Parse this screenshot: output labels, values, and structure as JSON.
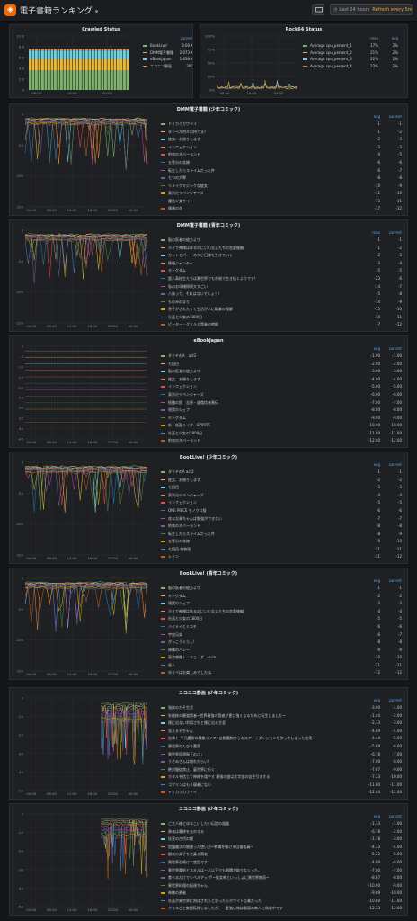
{
  "header": {
    "title": "電子書籍ランキング",
    "time_range": "Last 24 hours",
    "refresh": "Refresh every 5m"
  },
  "crawled": {
    "title": "Crawled Status",
    "col": "current",
    "legend": [
      {
        "name": "BookLive!",
        "value": "3.60 K",
        "color": "#7eb26d"
      },
      {
        "name": "DMM電子書籍",
        "value": "2.073 K",
        "color": "#eab839"
      },
      {
        "name": "eBookJapan",
        "value": "1.638 K",
        "color": "#6ed0e0"
      },
      {
        "name": "ニコニコ静画",
        "value": "300",
        "color": "#ef843c"
      }
    ],
    "chart_data": {
      "type": "bar",
      "y_ticks": [
        "10 K",
        "8 K",
        "6 K",
        "4 K",
        "2 K",
        "0"
      ],
      "x_ticks": [
        "08:00",
        "16:00",
        "00:00"
      ],
      "ylim": [
        0,
        10000
      ],
      "stacked": true,
      "series": [
        {
          "name": "BookLive!",
          "value": 3600
        },
        {
          "name": "DMM電子書籍",
          "value": 2073
        },
        {
          "name": "eBookJapan",
          "value": 1638
        },
        {
          "name": "ニコニコ静画",
          "value": 300
        }
      ]
    }
  },
  "rock64": {
    "title": "Rock64 Status",
    "cols": [
      "max",
      "avg"
    ],
    "legend": [
      {
        "name": "Average cpu_percent_1",
        "v1": "17%",
        "v2": "3%",
        "color": "#7eb26d"
      },
      {
        "name": "Average cpu_percent_2",
        "v1": "21%",
        "v2": "2%",
        "color": "#eab839"
      },
      {
        "name": "Average cpu_percent_3",
        "v1": "22%",
        "v2": "2%",
        "color": "#6ed0e0"
      },
      {
        "name": "Average cpu_percent_4",
        "v1": "22%",
        "v2": "2%",
        "color": "#ef843c"
      }
    ],
    "chart_data": {
      "type": "line",
      "y_ticks": [
        "100%",
        "75%",
        "50%",
        "25%",
        "0%"
      ],
      "x_ticks": [
        "08:00",
        "16:00",
        "00:00"
      ],
      "ylim": [
        0,
        100
      ]
    }
  },
  "panels": [
    {
      "title": "DMM電子書籍 (少年コミック)",
      "cols": [
        "avg",
        "current"
      ],
      "y_ticks": [
        "0",
        "-50",
        "-100",
        "-150"
      ],
      "x_ticks": [
        "04:00",
        "08:00",
        "12:00",
        "16:00",
        "20:00",
        "00:00"
      ],
      "rows": [
        [
          "ドミカクカワイイ",
          "-1",
          "-1"
        ],
        [
          "ダンベル何キロ持てる?",
          "-1",
          "-2"
        ],
        [
          "彼女、お借りします",
          "-2",
          "-3"
        ],
        [
          "インフェクション",
          "-3",
          "-3"
        ],
        [
          "約束のネバーランド",
          "-4",
          "-5"
        ],
        [
          "五等分の花嫁",
          "-6",
          "-6"
        ],
        [
          "転生したらスライムだった件",
          "-6",
          "-7"
        ],
        [
          "七つの大罪",
          "-8",
          "-8"
        ],
        [
          "リメイクマジックな彼女",
          "-10",
          "-9"
        ],
        [
          "東京卍リベンジャーズ",
          "-11",
          "-10"
        ],
        [
          "魔法少女サイト",
          "-13",
          "-11"
        ],
        [
          "僕達の花",
          "-17",
          "-12"
        ]
      ]
    },
    {
      "title": "DMM電子書籍 (青年コミック)",
      "cols": [
        "max",
        "current"
      ],
      "y_ticks": [
        "0",
        "-50",
        "-100",
        "-150"
      ],
      "x_ticks": [
        "04:00",
        "08:00",
        "12:00",
        "16:00",
        "20:00",
        "00:00"
      ],
      "rows": [
        [
          "脳の医者の彼方より",
          "-1",
          "-1"
        ],
        [
          "ホイで神様はゆるのにいい太またちの恋愛後編",
          "-1",
          "-2"
        ],
        [
          "カットとパートのクビ日常を生きていく",
          "-2",
          "-3"
        ],
        [
          "情報ジャンキー",
          "-3",
          "-4"
        ],
        [
          "キングダム",
          "-5",
          "-5"
        ],
        [
          "超人高校生たちは異世界でも余裕で生き抜くようです!",
          "-23",
          "-6"
        ],
        [
          "私のお母様探偵大すごい",
          "-14",
          "-7"
        ],
        [
          "八族って、それはないでしょう!",
          "-5",
          "-8"
        ],
        [
          "ものみのまり",
          "-14",
          "-9"
        ],
        [
          "息子がされたくて生活が人に職業の理解",
          "-15",
          "-10"
        ],
        [
          "社畜と少女の1800日",
          "-10",
          "-11"
        ],
        [
          "ピーター・グリルと賢者の時間",
          "-7",
          "-12"
        ]
      ]
    },
    {
      "title": "eBookJapan",
      "cols": [
        "avg",
        "current"
      ],
      "y_ticks": [
        "0",
        "-5",
        "-10",
        "-15",
        "-20",
        "-25",
        "-30",
        "-35",
        "-40",
        "-45"
      ],
      "x_ticks": [
        "04:00",
        "08:00",
        "12:00",
        "16:00",
        "20:00",
        "00:00"
      ],
      "rows": [
        [
          "ダイヤのA　act2",
          "-1.00",
          "-1.00"
        ],
        [
          "七回目",
          "-2.00",
          "-2.00"
        ],
        [
          "脳の医者の彼方より",
          "-3.00",
          "-3.00"
        ],
        [
          "彼女、お借りします",
          "-4.00",
          "-4.00"
        ],
        [
          "インフェクション",
          "-5.00",
          "-5.00"
        ],
        [
          "東京卍リベンジャーズ",
          "-6.00",
          "-6.00"
        ],
        [
          "極醜の国　志恵・盛倫信者異伝",
          "-7.00",
          "-7.00"
        ],
        [
          "現実のシェフ",
          "-8.00",
          "-8.00"
        ],
        [
          "キングダム",
          "-9.00",
          "-9.00"
        ],
        [
          "新　仮面ライダーSPIRITS",
          "-10.00",
          "-10.00"
        ],
        [
          "社畜と少女の1800日",
          "-11.00",
          "-11.00"
        ],
        [
          "約束のネバーランド",
          "-12.00",
          "-12.00"
        ]
      ]
    },
    {
      "title": "BookLive! (少年コミック)",
      "cols": [
        "avg",
        "current"
      ],
      "y_ticks": [
        "0",
        "-50",
        "-100",
        "-150"
      ],
      "x_ticks": [
        "04:00",
        "08:00",
        "12:00",
        "16:00",
        "20:00",
        "00:00"
      ],
      "rows": [
        [
          "ダイヤのA act2",
          "-1",
          "-1"
        ],
        [
          "彼女、お借りします",
          "-2",
          "-2"
        ],
        [
          "七回目",
          "-3",
          "-3"
        ],
        [
          "東京卍リベンジャーズ",
          "-4",
          "-4"
        ],
        [
          "インフェクション",
          "-5",
          "-5"
        ],
        [
          "ONE PIECE モノクロ版",
          "-6",
          "-6"
        ],
        [
          "花なな青ちゃんは勉強ができない",
          "-7",
          "-7"
        ],
        [
          "約束のネバーランド",
          "-8",
          "-8"
        ],
        [
          "転生したらスライムだった件",
          "-8",
          "-9"
        ],
        [
          "五等分の花嫁",
          "-9",
          "-10"
        ],
        [
          "七回目 特装版",
          "-11",
          "-11"
        ],
        [
          "レイン",
          "-11",
          "-12"
        ]
      ]
    },
    {
      "title": "BookLive! (青年コミック)",
      "cols": [
        "avg",
        "current"
      ],
      "y_ticks": [
        "0",
        "-50",
        "-100",
        "-150"
      ],
      "x_ticks": [
        "04:00",
        "08:00",
        "12:00",
        "16:00",
        "20:00",
        "00:00"
      ],
      "rows": [
        [
          "脳の医者の彼方より",
          "-1",
          "-1"
        ],
        [
          "キングダム",
          "-2",
          "-2"
        ],
        [
          "現実のシェフ",
          "-3",
          "-3"
        ],
        [
          "ホイで神様はゆるのにいい太またちの恋愛後編",
          "-4",
          "-4"
        ],
        [
          "社畜と少女の1800日",
          "-5",
          "-5"
        ],
        [
          "ハクメイとミコチ",
          "-6",
          "-6"
        ],
        [
          "宇宙兄弟",
          "-6",
          "-7"
        ],
        [
          "がっこうぐらし!",
          "-8",
          "-8"
        ],
        [
          "神様のバレー",
          "-9",
          "-9"
        ],
        [
          "東京喰種トーキョーグール:re",
          "-10",
          "-10"
        ],
        [
          "風人",
          "-21",
          "-11"
        ],
        [
          "ゆうべはお楽しみでしたね",
          "-12",
          "-12"
        ]
      ]
    },
    {
      "title": "ニコニコ静画 (少年コミック)",
      "cols": [
        "avg",
        "current"
      ],
      "y_ticks": [
        "0",
        "-10",
        "-20",
        "-30",
        "-40",
        "-50"
      ],
      "x_ticks": [
        "04:00",
        "08:00",
        "12:00",
        "16:00",
        "20:00",
        "00:00"
      ],
      "rows": [
        [
          "強欲のたそ生活",
          "-3.00",
          "-1.00"
        ],
        [
          "失格紋の最強賢者~世界最強の賢者が更に強くなるために転生しました~",
          "-1.44",
          "-2.00"
        ],
        [
          "僕に出ない利用されと僕に出る主君",
          "-2.33",
          "-3.00"
        ],
        [
          "見えるデちゃん",
          "-4.89",
          "-4.00"
        ],
        [
          "血骨ド-平凡魔術の凝集ライフ~自動魔物からのスアートダンジョンを作ってしまった結果~",
          "-4.44",
          "-5.00"
        ],
        [
          "異世界のんびり農家",
          "-5.89",
          "-6.00"
        ],
        [
          "異世界居酒屋「のぶ」",
          "-6.78",
          "-7.00"
        ],
        [
          "うさみさんは触れたらい!",
          "-7.00",
          "-8.00"
        ],
        [
          "絶対服従禁止、裏世界に行く",
          "-7.67",
          "-9.00"
        ],
        [
          "ホタルを信じて神様を増やす 最強の蛍は文字蛍の自主引きする",
          "-7.33",
          "-10.00"
        ],
        [
          "ゴブリンはもう弱者にない",
          "-11.00",
          "-11.00"
        ],
        [
          "ドミカクカワイイ",
          "-12.44",
          "-12.00"
        ]
      ]
    },
    {
      "title": "ニコニコ静画 (少年コミック)",
      "cols": [
        "avg",
        "current"
      ],
      "y_ticks": [
        "0",
        "-10",
        "-20",
        "-30",
        "-40",
        "-50"
      ],
      "x_ticks": [
        "04:00",
        "08:00",
        "12:00",
        "16:00",
        "20:00",
        "00:00"
      ],
      "rows": [
        [
          "ご主人様とゆるこいしたい伝説の道器",
          "-1.33",
          "-1.00"
        ],
        [
          "勇者は最終を支のろる",
          "-6.78",
          "-2.00"
        ],
        [
          "託宣の古代の鍵",
          "-1.78",
          "-3.00"
        ],
        [
          "加護魔法の間違った使い方~戦場を駆ける回復要員~",
          "-4.33",
          "-4.00"
        ],
        [
          "蹴者の弟子を名乗る賢者",
          "-5.22",
          "-5.00"
        ],
        [
          "異世界召喚は二度目です",
          "-4.89",
          "-6.00"
        ],
        [
          "異世界魔術とスキルは一人以下でも問題が取りなくった。",
          "-7.00",
          "-7.00"
        ],
        [
          "食べるだけでレベルアップ!~駄女神といっしょに異世界無双~",
          "-8.67",
          "-8.00"
        ],
        [
          "異世界料理の配達ちゃん",
          "-10.00",
          "-9.00"
        ],
        [
          "神様の勇者",
          "-9.89",
          "-10.00"
        ],
        [
          "社畜が異世界に飛ばされたと思ったらホワイト企業だった",
          "-10.89",
          "-11.00"
        ],
        [
          "クラスごと集団転移しましたが、一番強い俺は最弱の商人に偽装中です",
          "-12.33",
          "-12.00"
        ]
      ]
    }
  ]
}
